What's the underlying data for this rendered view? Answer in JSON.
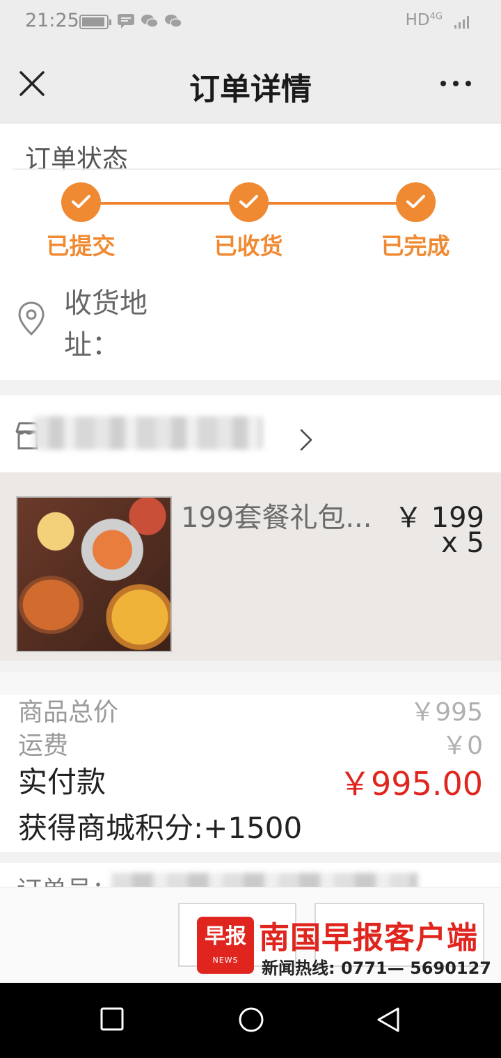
{
  "status_bar": {
    "time": "21:25",
    "network": "HD",
    "network_sup": "4G",
    "icons": [
      "battery-icon",
      "message-icon",
      "wechat-icon",
      "wechat-icon",
      "signal-icon"
    ]
  },
  "header": {
    "title": "订单详情",
    "icons": [
      "close-icon",
      "more-icon"
    ]
  },
  "order_status": {
    "section_title": "订单状态",
    "steps": [
      "已提交",
      "已收货",
      "已完成"
    ],
    "accent_color": "#f08a32"
  },
  "address": {
    "label": "收货地址："
  },
  "shop": {
    "icon": "shop-icon"
  },
  "product": {
    "name": "199套餐礼包...",
    "price": "￥ 199",
    "quantity": "x 5"
  },
  "totals": {
    "goods_label": "商品总价",
    "goods_value": "￥995",
    "shipping_label": "运费",
    "shipping_value": "￥0",
    "paid_label": "实付款",
    "paid_value": "￥995.00",
    "paid_color": "#e0251f",
    "points_text": "获得商城积分:+1500"
  },
  "order": {
    "number_label": "订单号："
  },
  "watermark": {
    "logo_text": "早报",
    "logo_sub": "NEWS",
    "title": "南国早报客户端",
    "hotline": "新闻热线: 0771— 5690127"
  },
  "nav_bar": {
    "icons": [
      "recent-apps-icon",
      "home-icon",
      "back-icon"
    ]
  }
}
